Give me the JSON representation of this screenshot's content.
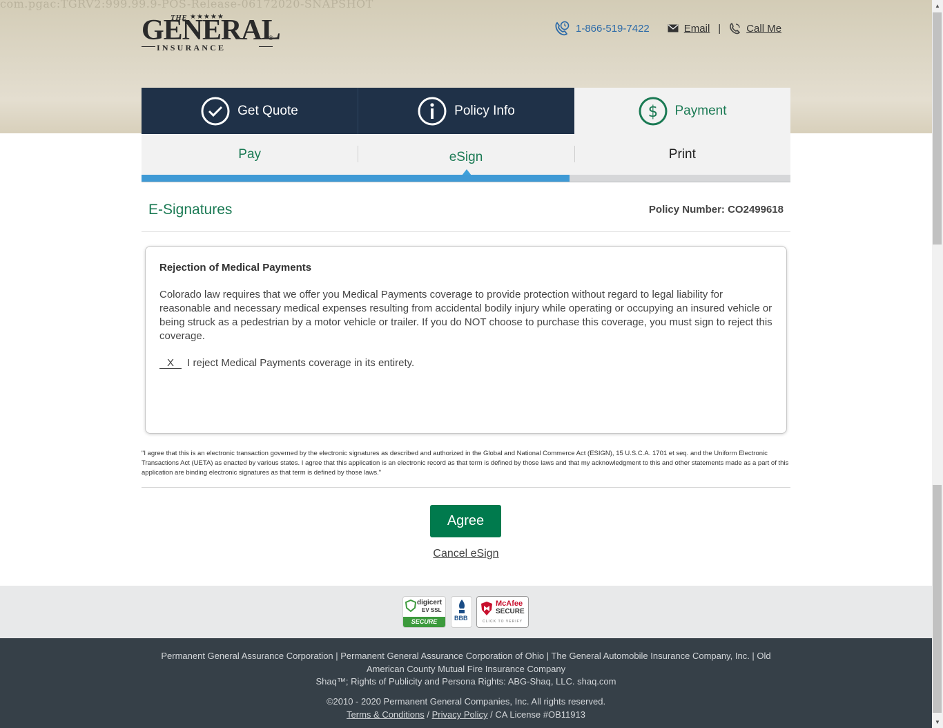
{
  "build_string": "com.pgac:TGRV2:999.99.9-POS-Release-06172020-SNAPSHOT",
  "logo": {
    "the": "THE",
    "stars": "★★★★★",
    "name": "GENERAL",
    "registered": "®",
    "subtitle": "INSURANCE"
  },
  "header": {
    "phone": "1-866-519-7422",
    "email_label": "Email",
    "separator": "|",
    "call_me_label": "Call Me"
  },
  "steps": [
    {
      "label": "Get Quote",
      "icon": "check-circle-icon"
    },
    {
      "label": "Policy Info",
      "icon": "info-circle-icon"
    },
    {
      "label": "Payment",
      "icon": "dollar-circle-icon",
      "active": true
    }
  ],
  "substeps": [
    {
      "label": "Pay"
    },
    {
      "label": "eSign",
      "current": true
    },
    {
      "label": "Print"
    }
  ],
  "progress": {
    "fraction": 0.66
  },
  "section": {
    "title": "E-Signatures",
    "policy_number": "Policy Number: CO2499618"
  },
  "document": {
    "title": "Rejection of Medical Payments",
    "body": "Colorado law requires that we offer you Medical Payments coverage to provide protection without regard to legal liability for reasonable and necessary medical expenses resulting from accidental bodily injury while operating or occupying an insured vehicle or being struck as a pedestrian by a motor vehicle or trailer. If you do NOT choose to purchase this coverage, you must sign to reject this coverage.",
    "reject_mark": "X",
    "reject_text": "I reject Medical Payments coverage in its entirety."
  },
  "legal": "\"I agree that this is an electronic transaction governed by the electronic signatures as described and authorized in the Global and National Commerce Act (ESIGN), 15 U.S.C.A. 1701 et seq. and the Uniform Electronic Transactions Act (UETA) as enacted by various states. I agree that this application is an electronic record as that term is defined by those laws and that my acknowledgment to this and other statements made as a part of this application are binding electronic signatures as that term is defined by those laws.\"",
  "actions": {
    "agree_label": "Agree",
    "cancel_label": "Cancel eSign"
  },
  "badges": {
    "digicert": [
      "digicert",
      "EV SSL",
      "SECURE"
    ],
    "bbb": [
      "BBB"
    ],
    "mcafee": [
      "McAfee",
      "SECURE",
      "CLICK TO VERIFY"
    ]
  },
  "footer": {
    "companies": "Permanent General Assurance Corporation | Permanent General Assurance Corporation of Ohio | The General Automobile Insurance Company, Inc. | Old American County Mutual Fire Insurance Company",
    "shaq": "Shaq™; Rights of Publicity and Persona Rights: ABG-Shaq, LLC. shaq.com",
    "copyright": "©2010 - 2020 Permanent General Companies, Inc. All rights reserved.",
    "terms_label": "Terms & Conditions",
    "slash1": "/",
    "privacy_label": "Privacy Policy",
    "license": "/ CA License #OB11913"
  },
  "colors": {
    "navy": "#1f3148",
    "green": "#007a4d",
    "blue": "#3f9ad5",
    "footer": "#364048"
  }
}
